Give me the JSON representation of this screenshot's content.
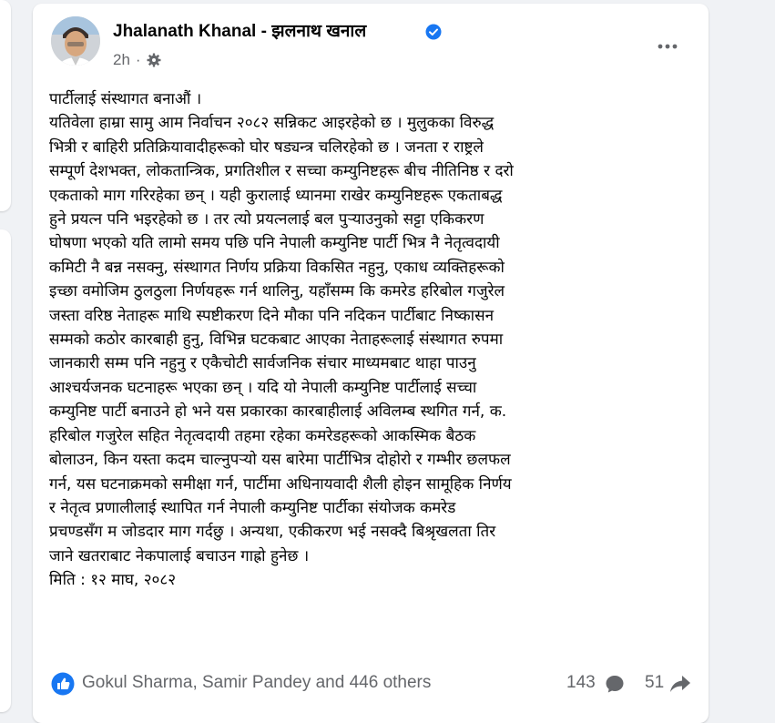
{
  "post": {
    "author_name": "Jhalanath Khanal - झलनाथ खनाल",
    "timestamp": "2h",
    "separator": "·",
    "privacy_icon": "gear-icon",
    "verified_icon": "verified-badge-icon",
    "more_icon": "more-horizontal-icon",
    "body_text": "पार्टीलाई संस्थागत बनाऔं ।\nयतिवेला हाम्रा सामु आम निर्वाचन २०८२ सन्निकट आइरहेको छ । मुलुकका विरुद्ध\nभित्री र बाहिरी प्रतिक्रियावादीहरूको घोर षड्यन्त्र चलिरहेको छ । जनता र राष्ट्रले\nसम्पूर्ण देशभक्त, लोकतान्त्रिक, प्रगतिशील र सच्चा कम्युनिष्टहरू बीच नीतिनिष्ठ र दरो\nएकताको माग गरिरहेका छन् । यही कुरालाई ध्यानमा राखेर कम्युनिष्टहरू एकताबद्ध\nहुने प्रयत्न पनि भइरहेको छ । तर त्यो प्रयत्नलाई बल पुर्‍याउनुको सट्टा एकिकरण\nघोषणा भएको यति लामो समय पछि पनि नेपाली कम्युनिष्ट पार्टी भित्र नै नेतृत्वदायी\nकमिटी नै बन्न नसक्नु, संस्थागत निर्णय प्रक्रिया विकसित नहुनु, एकाध व्यक्तिहरूको\nइच्छा वमोजिम ठुलठुला निर्णयहरू गर्न थालिनु, यहाँसम्म कि कमरेड हरिबोल गजुरेल\nजस्ता वरिष्ठ नेताहरू माथि स्पष्टीकरण दिने मौका पनि नदिकन पार्टीबाट निष्कासन\nसम्मको कठोर कारबाही हुनु, विभिन्न घटकबाट आएका नेताहरूलाई संस्थागत रुपमा\nजानकारी सम्म पनि नहुनु र एकैचोटी सार्वजनिक संचार माध्यमबाट थाहा पाउनु\nआश्चर्यजनक घटनाहरू भएका छन् ।  यदि यो नेपाली कम्युनिष्ट पार्टीलाई सच्चा\nकम्युनिष्ट पार्टी बनाउने हो भने यस प्रकारका कारबाहीलाई अविलम्ब स्थगित गर्न, क.\nहरिबोल गजुरेल सहित नेतृत्वदायी तहमा रहेका कमरेडहरूको आकस्मिक बैठक\nबोलाउन, किन यस्ता कदम चाल्नुपर्‍यो यस बारेमा पार्टीभित्र दोहोरो र गम्भीर छलफल\nगर्न, यस घटनाक्रमको समीक्षा गर्न, पार्टीमा अधिनायवादी शैली होइन सामूहिक निर्णय\nर नेतृत्व प्रणालीलाई स्थापित गर्न नेपाली कम्युनिष्ट पार्टीका संयोजक कमरेड\nप्रचण्डसँग म जोडदार माग गर्दछु । अन्यथा, एकीकरण भई नसक्दै बिश्रृखलता तिर\nजाने खतराबाट नेकपालाई बचाउन गाह्रो हुनेछ ।\nमिति : १२ माघ, २०८२"
  },
  "footer": {
    "reaction_icon": "like-reaction-icon",
    "reactions_text": "Gokul Sharma, Samir Pandey and 446 others",
    "comment_count": "143",
    "comment_icon": "comment-icon",
    "share_count": "51",
    "share_icon": "share-icon"
  },
  "colors": {
    "page_background": "#f0f2f5",
    "card_background": "#ffffff",
    "primary_text": "#050505",
    "secondary_text": "#65676b",
    "brand_blue": "#1877f2"
  }
}
